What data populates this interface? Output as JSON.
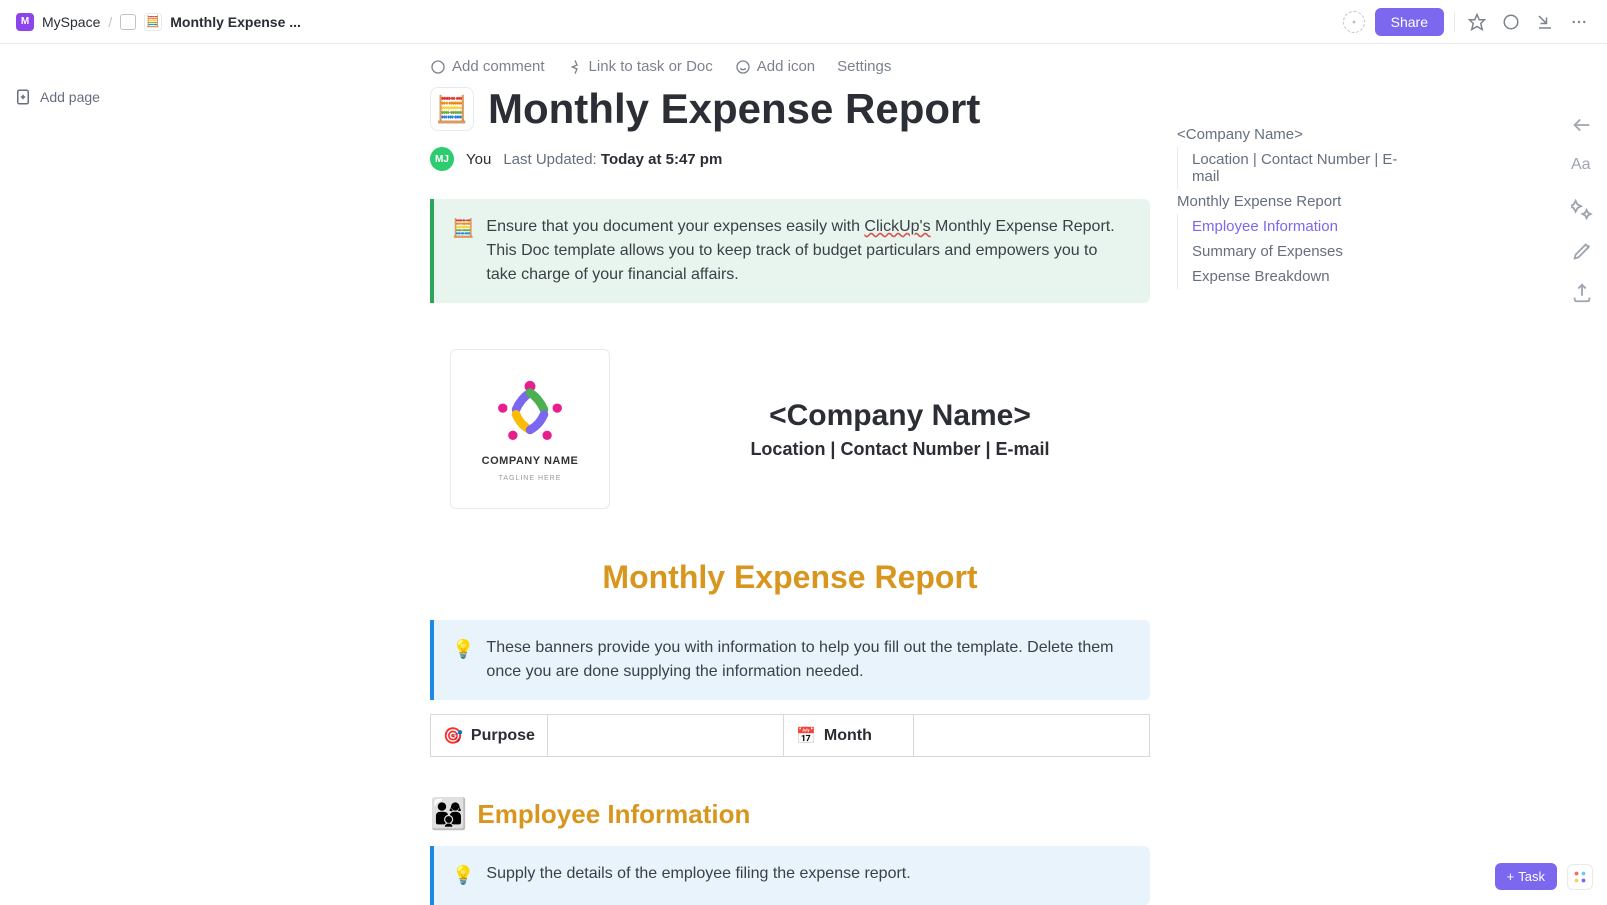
{
  "breadcrumb": {
    "space": "MySpace",
    "space_letter": "M",
    "doc": "Monthly Expense ..."
  },
  "topbar": {
    "share": "Share"
  },
  "sidebar": {
    "add_page": "Add page"
  },
  "toolbar": {
    "comment": "Add comment",
    "link": "Link to task or Doc",
    "icon": "Add icon",
    "settings": "Settings"
  },
  "doc": {
    "title": "Monthly Expense Report",
    "avatar_initials": "MJ",
    "author": "You",
    "updated_label": "Last Updated:",
    "updated_value": "Today at 5:47 pm"
  },
  "callouts": {
    "intro_pre": "Ensure that you document your expenses easily with ",
    "intro_link": "ClickUp's",
    "intro_post": " Monthly Expense Report. This Doc template allows you to keep track of budget particulars and empowers you to take charge of your financial affairs.",
    "banner_tip": "These banners provide you with information to help you fill out the template. Delete them once you are done supplying the information needed.",
    "employee_tip": "Supply the details of the employee filing the expense report."
  },
  "company": {
    "logo_name": "COMPANY NAME",
    "logo_tag": "TAGLINE HERE",
    "name": "<Company Name>",
    "sub": "Location | Contact Number | E-mail"
  },
  "sections": {
    "report_title": "Monthly Expense Report",
    "employee_title": "Employee Information",
    "purpose_label": "Purpose",
    "month_label": "Month"
  },
  "outline": [
    {
      "label": "<Company Name>",
      "level": 1,
      "active": false
    },
    {
      "label": "Location | Contact Number | E-mail",
      "level": 2,
      "active": false
    },
    {
      "label": "Monthly Expense Report",
      "level": 1,
      "active": false
    },
    {
      "label": "Employee Information",
      "level": 2,
      "active": true
    },
    {
      "label": "Summary of Expenses",
      "level": 2,
      "active": false
    },
    {
      "label": "Expense Breakdown",
      "level": 2,
      "active": false
    }
  ],
  "task_btn": "Task"
}
